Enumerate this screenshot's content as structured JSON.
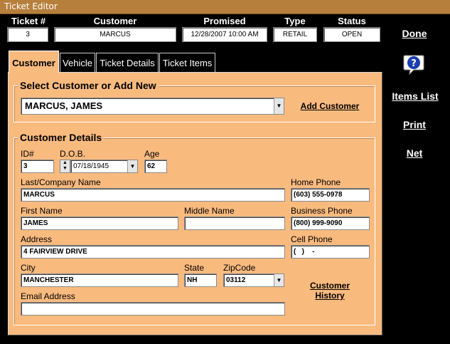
{
  "window": {
    "title": "Ticket Editor"
  },
  "header": {
    "ticket_label": "Ticket #",
    "ticket_value": "3",
    "customer_label": "Customer",
    "customer_value": "MARCUS",
    "promised_label": "Promised",
    "promised_value": "12/28/2007 10:00 AM",
    "type_label": "Type",
    "type_value": "RETAIL",
    "status_label": "Status",
    "status_value": "OPEN"
  },
  "sidebar": {
    "done": "Done",
    "items_list": "Items List",
    "print": "Print",
    "net": "Net"
  },
  "tabs": [
    {
      "label": "Customer",
      "active": true
    },
    {
      "label": "Vehicle",
      "active": false
    },
    {
      "label": "Ticket Details",
      "active": false
    },
    {
      "label": "Ticket Items",
      "active": false
    }
  ],
  "select_group": {
    "title": "Select Customer or Add New",
    "selected_customer": "MARCUS, JAMES",
    "add_customer": "Add Customer"
  },
  "details": {
    "title": "Customer Details",
    "id_label": "ID#",
    "id_value": "3",
    "dob_label": "D.O.B.",
    "dob_value": "07/18/1945",
    "age_label": "Age",
    "age_value": "62",
    "last_label": "Last/Company Name",
    "last_value": "MARCUS",
    "home_phone_label": "Home Phone",
    "home_phone_value": "(603) 555-0978",
    "first_label": "First Name",
    "first_value": "JAMES",
    "middle_label": "Middle Name",
    "middle_value": "",
    "business_phone_label": "Business Phone",
    "business_phone_value": "(800) 999-9090",
    "address_label": "Address",
    "address_value": "4 FAIRVIEW DRIVE",
    "cell_phone_label": "Cell Phone",
    "cell_phone_value": "(   )    -",
    "city_label": "City",
    "city_value": "MANCHESTER",
    "state_label": "State",
    "state_value": "NH",
    "zip_label": "ZipCode",
    "zip_value": "03112",
    "email_label": "Email Address",
    "email_value": "",
    "customer_history_line1": "Customer",
    "customer_history_line2": "History"
  },
  "colors": {
    "background": "#000000",
    "panel": "#f9ba7e",
    "titlebar": "#b77f3c",
    "help_icon": "#1b3fb0"
  },
  "icons": [
    "help-icon",
    "dropdown-arrow-icon",
    "spin-up-down-icon"
  ]
}
